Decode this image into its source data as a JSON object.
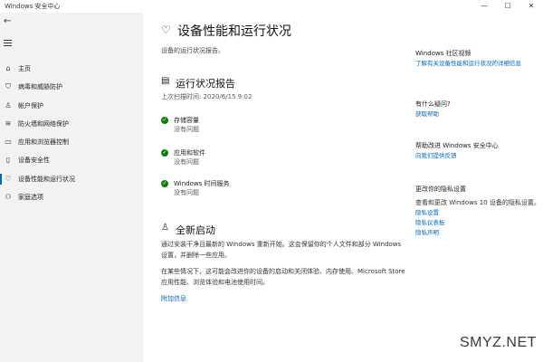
{
  "window": {
    "title": "Windows 安全中心",
    "minimize": "—",
    "maximize": "☐",
    "close": "✕"
  },
  "sidebar": {
    "back": "←",
    "items": [
      {
        "label": "主页",
        "icon": "home-icon",
        "glyph": "⌂"
      },
      {
        "label": "病毒和威胁防护",
        "icon": "shield-icon",
        "glyph": "⛉"
      },
      {
        "label": "帐户保护",
        "icon": "person-icon",
        "glyph": "♙"
      },
      {
        "label": "防火墙和网络保护",
        "icon": "wifi-icon",
        "glyph": "≋"
      },
      {
        "label": "应用和浏览器控制",
        "icon": "app-window-icon",
        "glyph": "▭"
      },
      {
        "label": "设备安全性",
        "icon": "device-icon",
        "glyph": "▯"
      },
      {
        "label": "设备性能和运行状况",
        "icon": "heart-icon",
        "glyph": "♡"
      },
      {
        "label": "家庭选项",
        "icon": "family-icon",
        "glyph": "⚇"
      }
    ]
  },
  "main": {
    "title": "设备性能和运行状况",
    "subtitle": "设备的运行状况报告。",
    "report": {
      "title": "运行状况报告",
      "last_scan": "上次扫描时间: 2020/6/15 9:02",
      "items": [
        {
          "name": "存储容量",
          "status": "没有问题"
        },
        {
          "name": "应用和软件",
          "status": "没有问题"
        },
        {
          "name": "Windows 时间服务",
          "status": "没有问题"
        }
      ]
    },
    "fresh_start": {
      "title": "全新启动",
      "para1": "通过安装干净且最新的 Windows 重新开始。这会保留你的个人文件和部分 Windows 设置，并删除一些应用。",
      "para2": "在某些情况下，这可能会改进你的设备的启动和关闭体验、内存使用、Microsoft Store 应用性能、浏览体验和电池使用时间。",
      "link": "附加信息"
    }
  },
  "right": {
    "community": {
      "heading": "Windows 社区视频",
      "link": "了解有关设备性能和运行状况的详细信息"
    },
    "question": {
      "heading": "有什么疑问?",
      "link": "获取帮助"
    },
    "improve": {
      "heading": "帮助改进 Windows 安全中心",
      "link": "向我们提供反馈"
    },
    "privacy": {
      "heading": "更改你的隐私设置",
      "text": "查看和更改 Windows 10 设备的隐私设置。",
      "links": [
        "隐私设置",
        "隐私仪表板",
        "隐私声明"
      ]
    }
  },
  "watermark": "SMYZ.NET"
}
